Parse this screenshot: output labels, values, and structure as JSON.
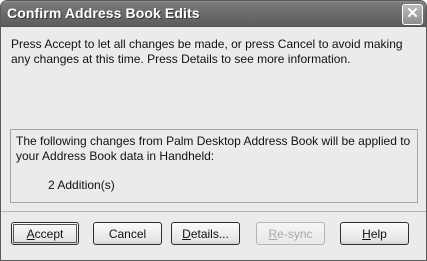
{
  "dialog": {
    "title": "Confirm Address Book Edits",
    "close_glyph": "✕",
    "intro_text": "Press Accept to let all changes be made, or press Cancel to avoid making any changes at this time. Press Details to see more information.",
    "changes_text": "The following changes from Palm Desktop Address Book will be applied to your Address Book data in Handheld:",
    "changes_count": "2 Addition(s)"
  },
  "buttons": {
    "accept": {
      "first": "A",
      "rest": "ccept"
    },
    "cancel": "Cancel",
    "details": {
      "first": "D",
      "rest": "etails..."
    },
    "resync": {
      "first": "R",
      "rest": "e-sync"
    },
    "help": {
      "first": "H",
      "rest": "elp"
    }
  }
}
